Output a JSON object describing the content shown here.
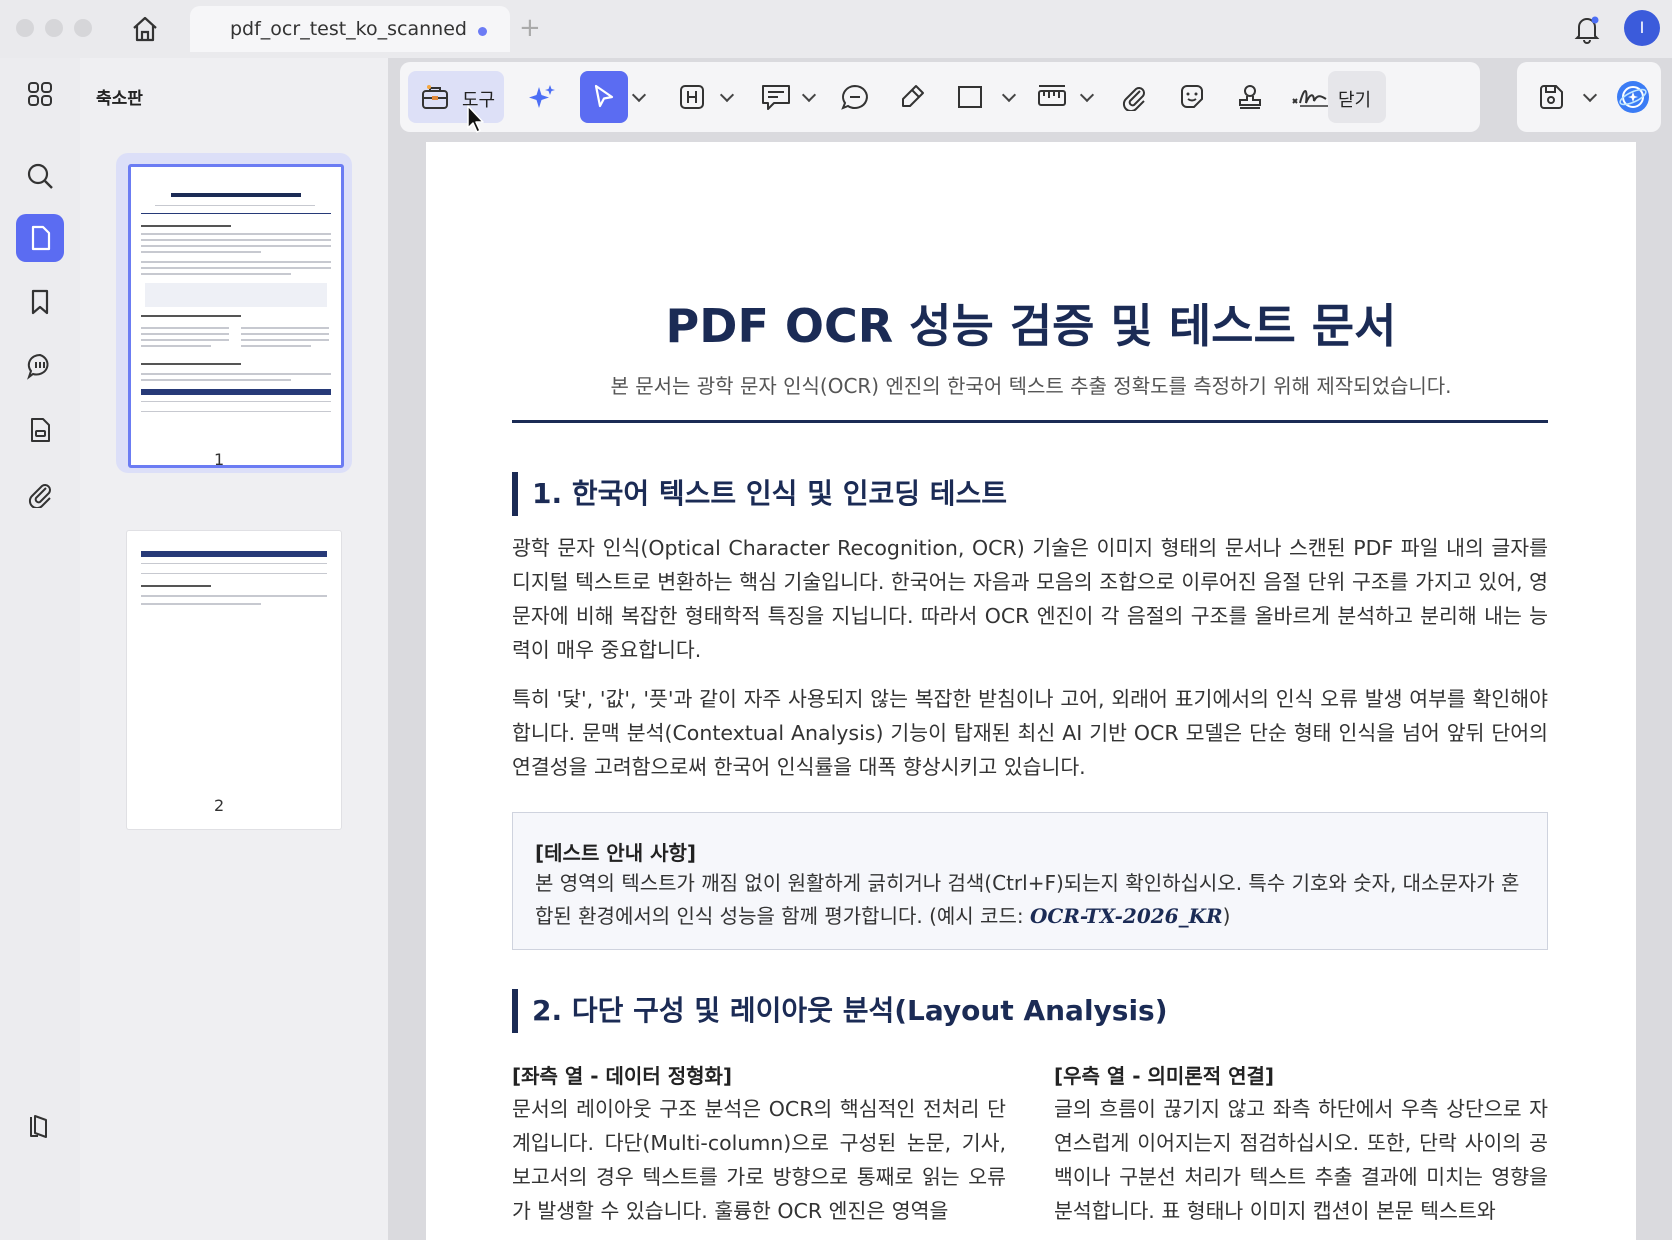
{
  "window": {
    "tab_title": "pdf_ocr_test_ko_scanned",
    "new_tab_symbol": "+",
    "avatar_initial": "I"
  },
  "sidebar": {
    "panel_title": "축소판",
    "pages": [
      {
        "number": "1",
        "selected": true
      },
      {
        "number": "2",
        "selected": false
      }
    ],
    "rail_icons": [
      "grid-icon",
      "search-icon",
      "page-icon",
      "bookmark-icon",
      "comment-icon",
      "document-icon",
      "attachment-icon",
      "layers-icon"
    ]
  },
  "toolbar": {
    "tools_label": "도구",
    "close_label": "닫기",
    "icons": [
      "tools-icon",
      "ai-sparkle-icon",
      "select-cursor-icon",
      "text-box-icon",
      "comment-icon",
      "note-icon",
      "highlighter-icon",
      "rectangle-icon",
      "measure-icon",
      "attachment-icon",
      "sticker-icon",
      "stamp-icon",
      "signature-icon",
      "save-icon",
      "ai-assistant-icon"
    ]
  },
  "document": {
    "title": "PDF OCR 성능 검증 및 테스트 문서",
    "subtitle": "본 문서는 광학 문자 인식(OCR) 엔진의 한국어 텍스트 추출 정확도를 측정하기 위해 제작되었습니다.",
    "section1": {
      "heading": "1. 한국어 텍스트 인식 및 인코딩 테스트",
      "para1": "광학 문자 인식(Optical Character Recognition, OCR) 기술은 이미지 형태의 문서나 스캔된 PDF 파일 내의 글자를 디지털 텍스트로 변환하는 핵심 기술입니다. 한국어는 자음과 모음의 조합으로 이루어진 음절 단위 구조를 가지고 있어, 영문자에 비해 복잡한 형태학적 특징을 지닙니다. 따라서 OCR 엔진이 각 음절의 구조를 올바르게 분석하고 분리해 내는 능력이 매우 중요합니다.",
      "para2": "특히 '닻', '값', '픗'과 같이 자주 사용되지 않는 복잡한 받침이나 고어, 외래어 표기에서의 인식 오류 발생 여부를 확인해야 합니다. 문맥 분석(Contextual Analysis) 기능이 탑재된 최신 AI 기반 OCR 모델은 단순 형태 인식을 넘어 앞뒤 단어의 연결성을 고려함으로써 한국어 인식률을 대폭 향상시키고 있습니다."
    },
    "notice": {
      "title": "[테스트 안내 사항]",
      "body": "본 영역의 텍스트가 깨짐 없이 원활하게 긁히거나 검색(Ctrl+F)되는지 확인하십시오. 특수 기호와 숫자, 대소문자가 혼합된 환경에서의 인식 성능을 함께 평가합니다. (예시 코드: ",
      "code": "OCR-TX-2026_KR",
      "close_paren": ")"
    },
    "section2": {
      "heading": "2. 다단 구성 및 레이아웃 분석(Layout Analysis)",
      "left_title": "[좌측 열 - 데이터 정형화]",
      "left_body": "문서의 레이아웃 구조 분석은 OCR의 핵심적인 전처리 단계입니다. 다단(Multi-column)으로 구성된 논문, 기사, 보고서의 경우 텍스트를 가로 방향으로 통째로 읽는 오류가 발생할 수 있습니다. 훌륭한 OCR 엔진은 영역을",
      "right_title": "[우측 열 - 의미론적 연결]",
      "right_body": "글의 흐름이 끊기지 않고 좌측 하단에서 우측 상단으로 자연스럽게 이어지는지 점검하십시오. 또한, 단락 사이의 공백이나 구분선 처리가 텍스트 추출 결과에 미치는 영향을 분석합니다. 표 형태나 이미지 캡션이 본문 텍스트와"
    }
  },
  "colors": {
    "accent": "#5b6cf2",
    "heading_navy": "#1b2b55",
    "thumb_selected_bg": "#dcdff8"
  }
}
